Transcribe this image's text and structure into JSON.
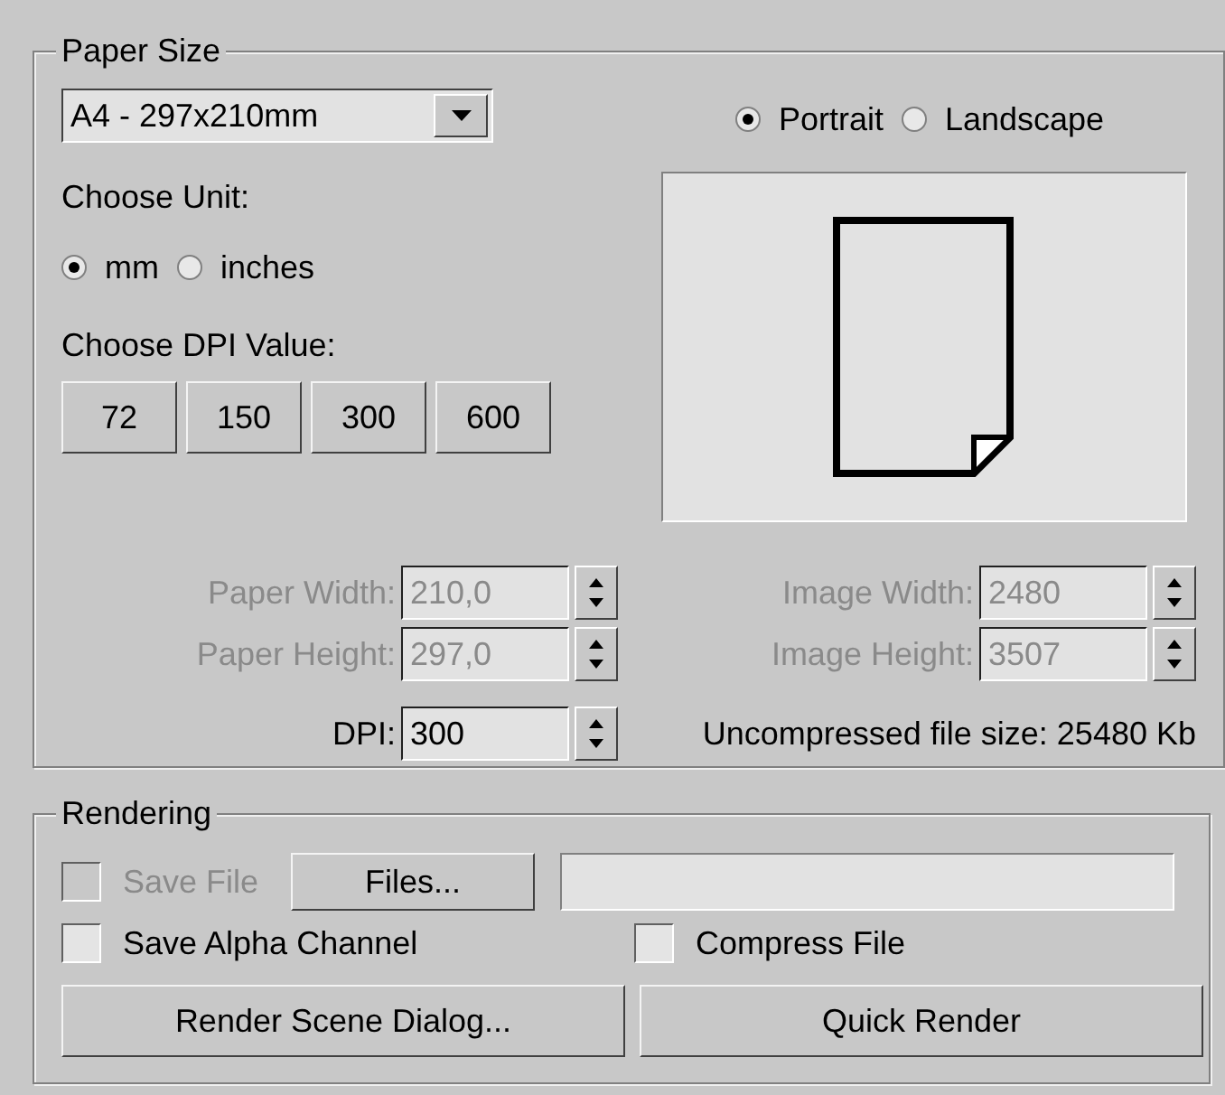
{
  "paper_size": {
    "title": "Paper Size",
    "dropdown": {
      "value": "A4 - 297x210mm"
    },
    "unit_label": "Choose Unit:",
    "units": [
      {
        "label": "mm",
        "selected": true
      },
      {
        "label": "inches",
        "selected": false
      }
    ],
    "dpi_label": "Choose DPI Value:",
    "dpi_buttons": [
      "72",
      "150",
      "300",
      "600"
    ],
    "orientation": [
      {
        "label": "Portrait",
        "selected": true
      },
      {
        "label": "Landscape",
        "selected": false
      }
    ],
    "left_fields": [
      {
        "label": "Paper Width:",
        "value": "210,0",
        "disabled": true
      },
      {
        "label": "Paper Height:",
        "value": "297,0",
        "disabled": true
      },
      {
        "label": "DPI:",
        "value": "300",
        "disabled": false
      }
    ],
    "right_fields": [
      {
        "label": "Image Width:",
        "value": "2480",
        "disabled": true
      },
      {
        "label": "Image Height:",
        "value": "3507",
        "disabled": true
      }
    ],
    "file_size": "Uncompressed file size: 25480 Kb"
  },
  "rendering": {
    "title": "Rendering",
    "save_file": {
      "label": "Save File",
      "checked": false,
      "disabled": true
    },
    "files_button": "Files...",
    "options": [
      {
        "label": "Save Alpha Channel",
        "checked": false
      },
      {
        "label": "Compress File",
        "checked": false
      }
    ],
    "buttons": [
      "Render Scene Dialog...",
      "Quick Render"
    ]
  }
}
